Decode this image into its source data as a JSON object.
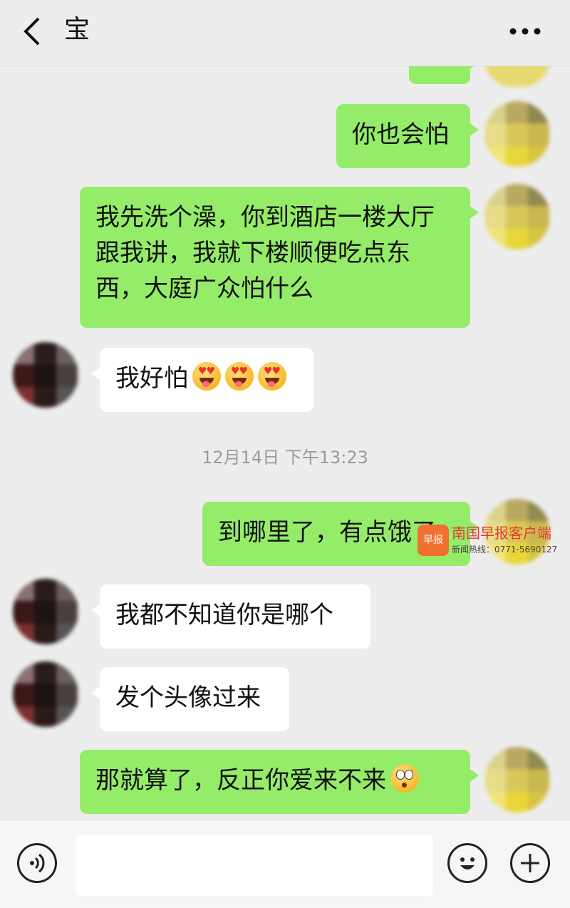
{
  "header": {
    "title": "宝",
    "back_icon": "chevron-left-icon",
    "more_icon": "more-dots-icon"
  },
  "messages": [
    {
      "side": "me",
      "text": "你也会怕"
    },
    {
      "side": "me",
      "text": "我先洗个澡，你到酒店一楼大厅跟我讲，我就下楼顺便吃点东西，大庭广众怕什么"
    },
    {
      "side": "them",
      "text": "我好怕",
      "emoji": [
        "heart-eyes-tongue",
        "heart-eyes-tongue",
        "heart-eyes-tongue"
      ]
    },
    {
      "side": "me",
      "text": "到哪里了，有点饿了"
    },
    {
      "side": "them",
      "text": "我都不知道你是哪个"
    },
    {
      "side": "them",
      "text": "发个头像过来"
    },
    {
      "side": "me",
      "text": "那就算了，反正你爱来不来",
      "emoji": [
        "flushed-face"
      ]
    }
  ],
  "timestamp": "12月14日 下午13:23",
  "watermark": {
    "logo": "早报",
    "name": "南国早报客户端",
    "hotline": "新闻热线：0771-5690127"
  },
  "input": {
    "value": "",
    "voice_icon": "voice-icon",
    "emoji_icon": "smiley-icon",
    "plus_icon": "plus-icon"
  },
  "colors": {
    "me_bubble": "#95ec69",
    "them_bubble": "#ffffff",
    "background": "#ededed"
  }
}
